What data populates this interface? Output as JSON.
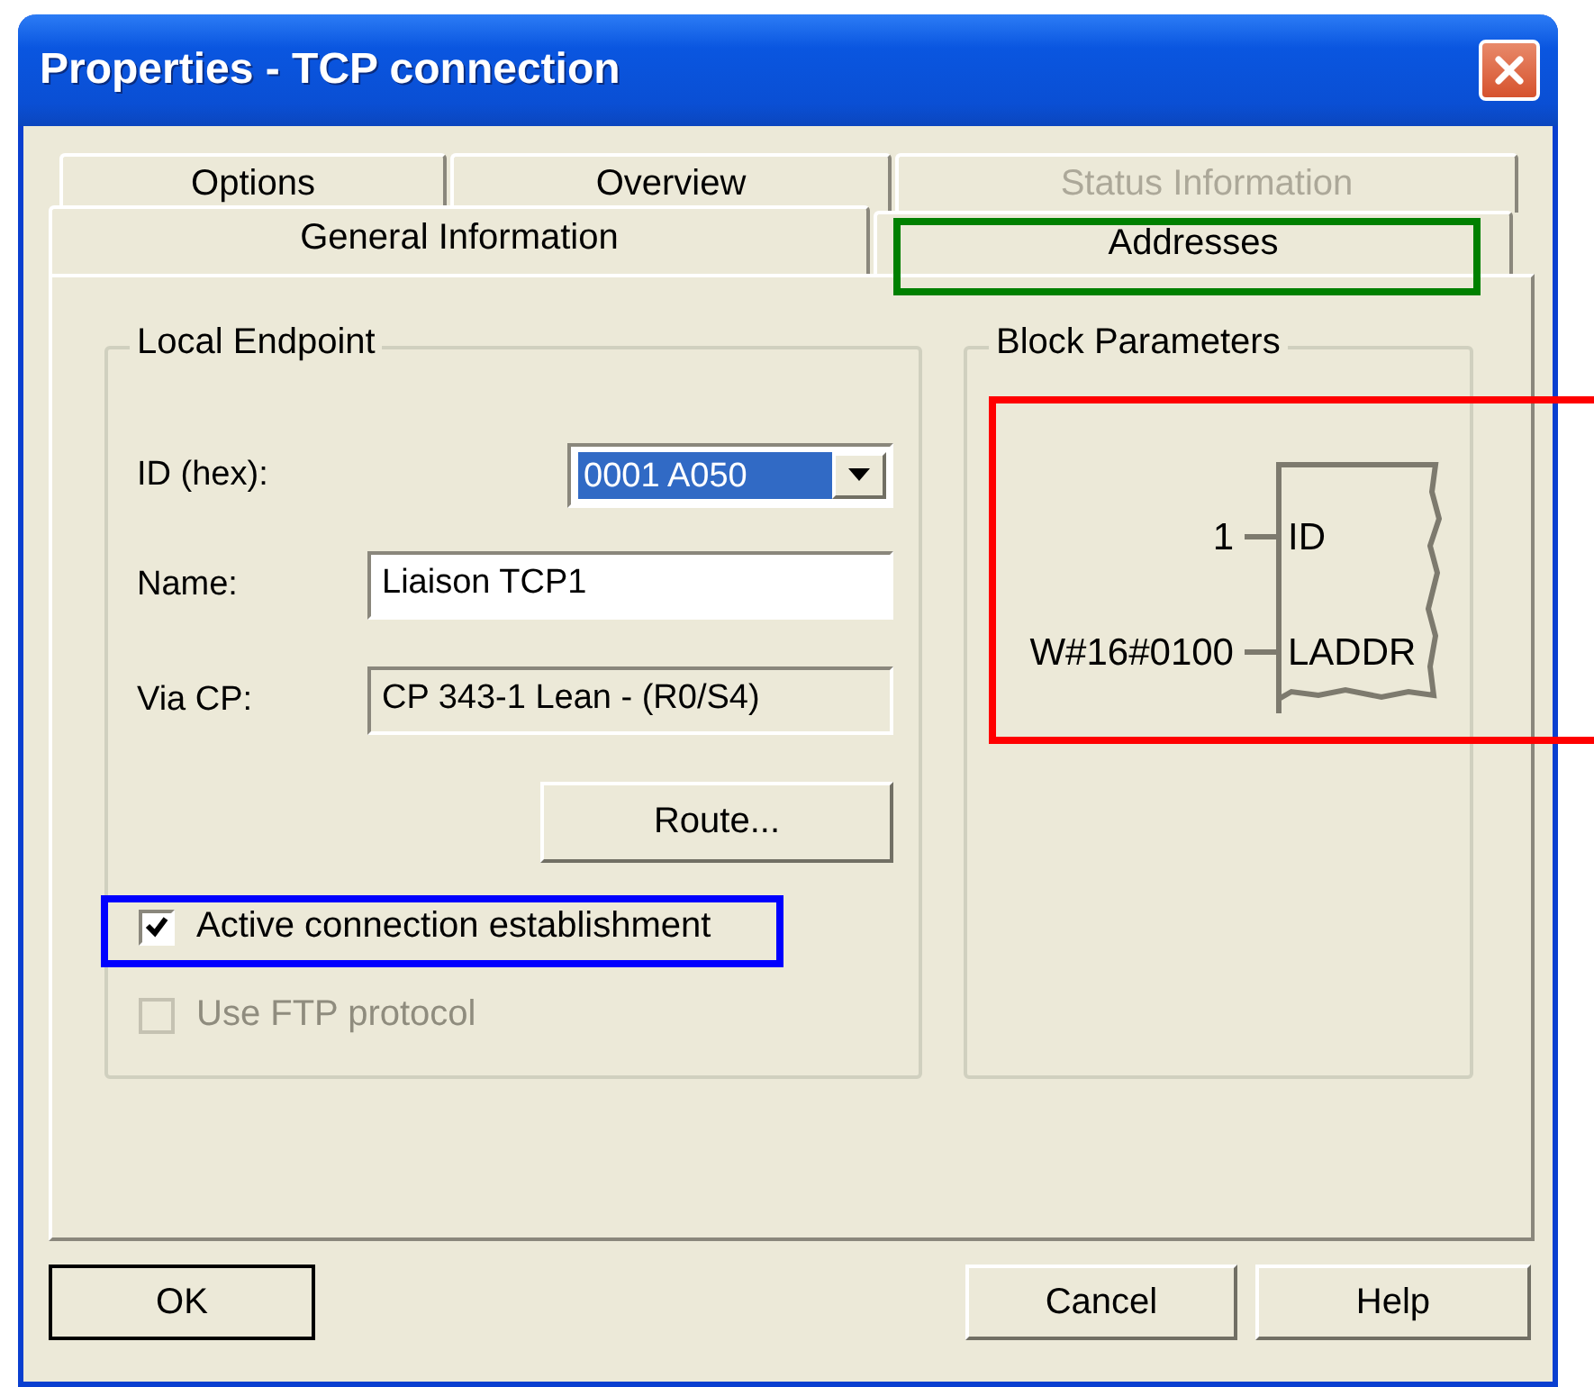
{
  "window": {
    "title": "Properties - TCP connection"
  },
  "tab_rows": [
    {
      "tabs": [
        {
          "label": "Options",
          "selected": false,
          "disabled": false
        },
        {
          "label": "Overview",
          "selected": false,
          "disabled": false
        },
        {
          "label": "Status Information",
          "selected": false,
          "disabled": true
        }
      ]
    },
    {
      "tabs": [
        {
          "label": "General Information",
          "selected": true,
          "disabled": false
        },
        {
          "label": "Addresses",
          "selected": false,
          "disabled": false
        }
      ]
    }
  ],
  "local_endpoint": {
    "title": "Local Endpoint",
    "fields": [
      {
        "kind": "combo",
        "label": "ID (hex):",
        "value": "0001 A050"
      },
      {
        "kind": "input",
        "label": "Name:",
        "value": "Liaison TCP1"
      },
      {
        "kind": "readonly",
        "label": "Via CP:",
        "value": "CP 343-1 Lean - (R0/S4)"
      }
    ],
    "route_button": "Route...",
    "checkboxes": [
      {
        "label": "Active connection establishment",
        "checked": true,
        "disabled": false
      },
      {
        "label": "Use FTP protocol",
        "checked": false,
        "disabled": true
      }
    ]
  },
  "block_parameters": {
    "title": "Block Parameters",
    "inputs": [
      {
        "value": "1",
        "pin": "ID"
      },
      {
        "value": "W#16#0100",
        "pin": "LADDR"
      }
    ]
  },
  "buttons": [
    {
      "label": "OK",
      "default": true
    },
    {
      "label": "Cancel",
      "default": false
    },
    {
      "label": "Help",
      "default": false
    }
  ],
  "annotations": [
    {
      "color": "#008000"
    },
    {
      "color": "#0000ff"
    },
    {
      "color": "#ff0000"
    }
  ]
}
